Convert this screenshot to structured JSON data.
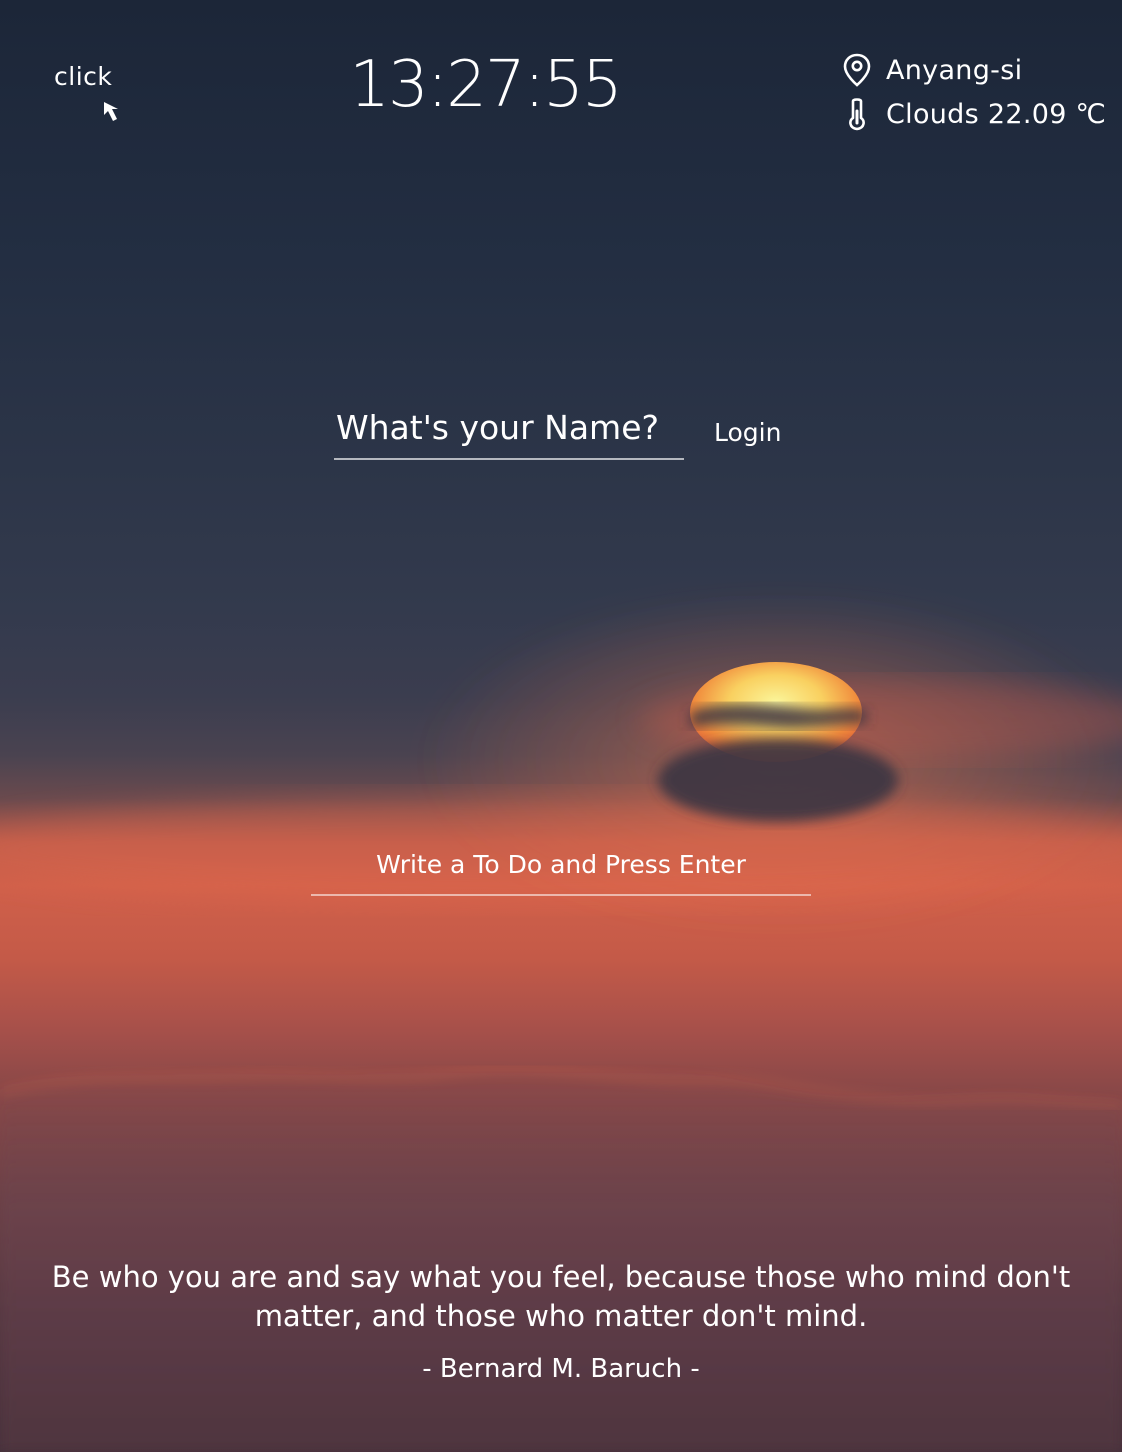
{
  "greeting_hint": {
    "label": "click",
    "icon": "cursor-arrow-icon"
  },
  "clock": {
    "time": "13:27:55"
  },
  "weather": {
    "location": "Anyang-si",
    "condition": "Clouds 22.09 ℃",
    "location_icon": "location-pin-icon",
    "temperature_icon": "thermometer-icon"
  },
  "login": {
    "name_placeholder": "What's your Name?",
    "button_label": "Login"
  },
  "todo": {
    "placeholder": "Write a To Do and Press Enter"
  },
  "quote": {
    "text": "Be who you are and say what you feel, because those who mind don't matter, and those who matter don't mind.",
    "author": "- Bernard M. Baruch -"
  },
  "colors": {
    "text": "#ffffff",
    "sky_top": "#1c2638",
    "sunset_glow": "#d0604a",
    "sun": "#f6e27a"
  }
}
